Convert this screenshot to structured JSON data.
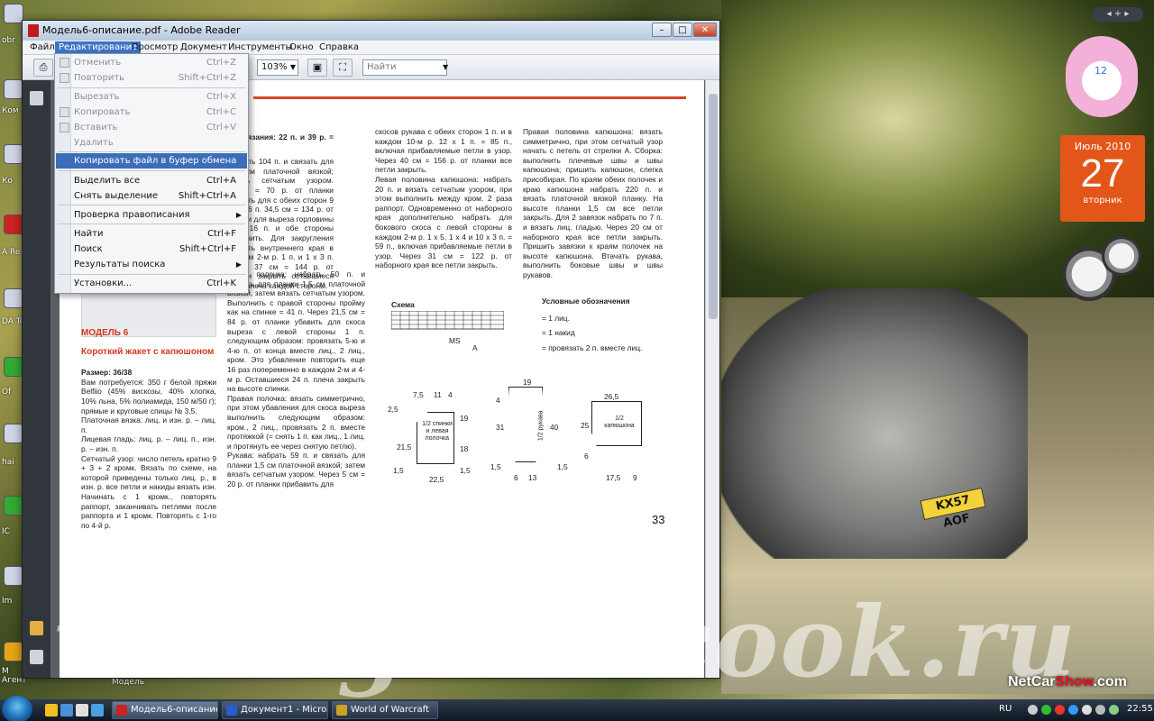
{
  "window": {
    "title": "Модель6-описание.pdf - Adobe Reader",
    "minimize": "–",
    "maximize": "□",
    "close": "✕"
  },
  "menubar": [
    "Файл",
    "Редактирование",
    "Просмотр",
    "Документ",
    "Инструменты",
    "Окно",
    "Справка"
  ],
  "toolbar": {
    "zoom": "103%",
    "search_placeholder": "Найти"
  },
  "edit_menu": [
    {
      "label": "Отменить",
      "shortcut": "Ctrl+Z",
      "disabled": true
    },
    {
      "label": "Повторить",
      "shortcut": "Shift+Ctrl+Z",
      "disabled": true
    },
    {
      "label": "Вырезать",
      "shortcut": "Ctrl+X",
      "disabled": true
    },
    {
      "label": "Копировать",
      "shortcut": "Ctrl+C",
      "disabled": true
    },
    {
      "label": "Вставить",
      "shortcut": "Ctrl+V",
      "disabled": true
    },
    {
      "label": "Удалить",
      "shortcut": "",
      "disabled": true
    },
    {
      "label": "Копировать файл в буфер обмена",
      "shortcut": "",
      "highlight": true
    },
    {
      "label": "Выделить все",
      "shortcut": "Ctrl+A"
    },
    {
      "label": "Снять выделение",
      "shortcut": "Shift+Ctrl+A"
    },
    {
      "label": "Проверка правописания",
      "shortcut": "",
      "submenu": true
    },
    {
      "label": "Найти",
      "shortcut": "Ctrl+F"
    },
    {
      "label": "Поиск",
      "shortcut": "Shift+Ctrl+F"
    },
    {
      "label": "Результаты поиска",
      "shortcut": "",
      "submenu": true
    },
    {
      "label": "Установки...",
      "shortcut": "Ctrl+K"
    }
  ],
  "document": {
    "col1_top": "сть вязания: 22 п. и 39 р. = 10",
    "col1_body": "набрать 104 п. и связать для 1,5 см платочной вязкой; вязать сетчатым узором. Через = 70 р. от планки закрыть для с обеих сторон 9 п. = 86 п. 34,5 см = 134 р. от планки для выреза горловины сред 16 п. и обе стороны закончить. Для закругления закрыть внутреннего края в каждом 2-м р. 1 п. и 1 х 3 п. Через 37 см = 144 р. от планки закрыть оставшиеся 24 п. плеча каждой стороны.",
    "model_title": "МОДЕЛЬ 6",
    "model_subtitle": "Короткий жакет с капюшоном",
    "size": "Размер: 36/38",
    "materials": "Вам потребуется: 350 г белой пряжи Belfiio (45% вискозы, 40% хлопка, 10% льна, 5% полиамида, 150 м/50 г); прямые и круговые спицы № 3,5.",
    "stitch1": "Платочная вязка: лиц. и изн. р. – лиц. п.",
    "stitch2": "Лицевая гладь: лиц. р. – лиц. п., изн. р. – изн. п.",
    "stitch3": "Сетчатый узор: число петель кратно 9 + 3 + 2 кромк. Вязать по схеме, на которой приведены только лиц. р., в изн. р. все петли и накиды вязать изн. Начинать с 1 кромк., повторять раппорт, заканчивать петлями после раппорта и 1 кромк. Повторять с 1-го по 4-й р.",
    "col2_body": "Левая полочка: набрать 50 п. и связать для планки 1,5 см платочной вязкой, затем вязать сетчатым узором. Выполнить с правой стороны пройму как на спинке = 41 п. Через 21,5 см = 84 р. от планки убавить для скоса выреза с левой стороны 1 п. следующим образом: провязать 5-ю и 4-ю п. от конца вместе лиц., 2 лиц., кром. Это убавление повторить еще 16 раз попеременно в каждом 2-м и 4-м р. Оставшиеся 24 п. плеча закрыть на высоте спинки.",
    "col2_body2": "Правая полочка: вязать симметрично, при этом убавления для скоса выреза выполнить следующим образом: кром., 2 лиц., провязать 2 п. вместе протяжкой (= снять 1 п. как лиц., 1 лиц. и протянуть ее через снятую петлю).",
    "col2_body3": "Рукава: набрать 59 п. и связать для планки 1,5 см платочной вязкой; затем вязать сетчатым узором. Через 5 см = 20 р. от планки прибавить для",
    "col3_body": "скосов рукава с обеих сторон 1 п. и в каждом 10-м р. 12 х 1 п. = 85 п., включая прибавляемые петли в узор. Через 40 см = 156 р. от планки все петли закрыть.",
    "col3_body2": "Левая половина капюшона: набрать 20 п. и вязать сетчатым узором, при этом выполнить между кром. 2 раза раппорт. Одновременно от наборного края дополнительно набрать для бокового скоса с левой стороны в каждом 2-м р. 1 х 5, 1 х 4 и 10 х 3 п. = 59 п., включая прибавляемые петли в узор. Через 31 см = 122 р. от наборного края все петли закрыть.",
    "col4_body": "Правая половина капюшона: вязать симметрично, при этом сетчатый узор начать с петель от стрелки А. Сборка: выполнить плечевые швы и швы капюшона; пришить капюшон, слегка присобирая. По краям обеих полочек и краю капюшона набрать 220 п. и вязать платочной вязкой планку. На высоте планки 1,5 см все петли закрыть. Для 2 завязок набрать по 7 п. и вязать лиц. гладью. Через 20 см от наборного края все петли закрыть. Пришить завязки к краям полочек на высоте капюшона. Втачать рукава, выполнить боковые швы и швы рукавов.",
    "schema_label": "Схема",
    "legend_title": "Условные обозначения",
    "legend": [
      "= 1 лиц.",
      "= 1 накид",
      "= провязать 2 п. вместе лиц."
    ],
    "page_number": "33",
    "ms": "MS",
    "arrow_a": "A",
    "piece1_label": "1/2 спинки и левая полочка",
    "piece2_label": "1/2 рукава",
    "piece3_label": "1/2 капюшона",
    "dims1": [
      "7,5",
      "11",
      "4",
      "2,5",
      "19",
      "21,5",
      "18",
      "1,5",
      "22,5",
      "1,5"
    ],
    "dims2": [
      "19",
      "4",
      "31",
      "40",
      "1,5",
      "6",
      "13",
      "1,5"
    ],
    "dims3": [
      "26,5",
      "25",
      "6",
      "17,5",
      "9"
    ]
  },
  "gadgets": {
    "sidebar_controls": "◂ + ▸",
    "clock_num": "12",
    "calendar_month": "Июль 2010",
    "calendar_day": "27",
    "calendar_weekday": "вторник"
  },
  "desktop": {
    "watermark": "www.good-cook.ru",
    "brand_a": "NetCar",
    "brand_b": "Show",
    "brand_c": ".com",
    "plate": "KX57 AOF",
    "icon_labels": [
      "obr",
      "Ком",
      "Ко",
      "A Re",
      "DA To",
      "Of",
      "hai",
      "IC",
      "Im",
      "M Агент"
    ],
    "file_icon_label": "Модель"
  },
  "taskbar": {
    "tasks": [
      "Модель6-описание...",
      "Документ1 - Micros...",
      "World of Warcraft"
    ],
    "lang": "RU",
    "time": "22:55"
  }
}
